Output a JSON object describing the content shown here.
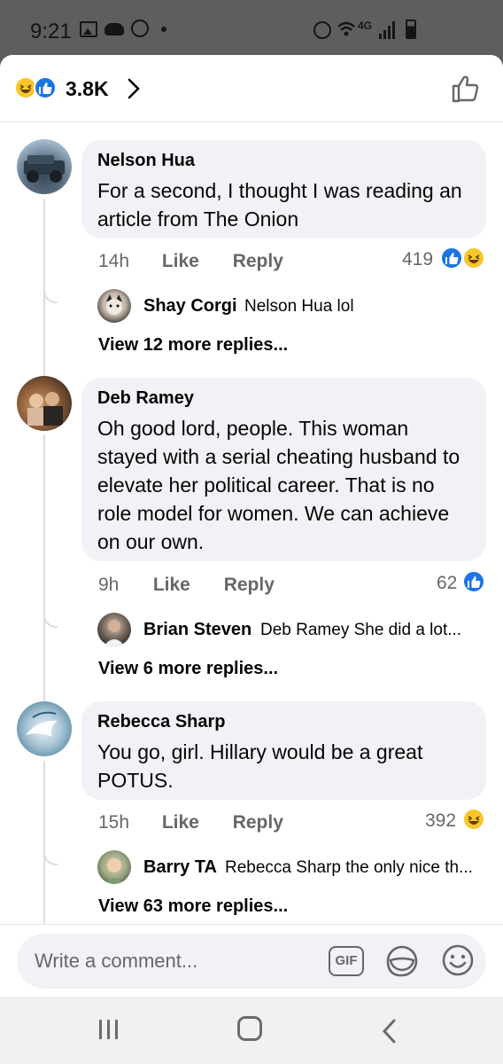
{
  "status_bar": {
    "time": "9:21",
    "network": "4G"
  },
  "header": {
    "reaction_count": "3.8K"
  },
  "comments": [
    {
      "author": "Nelson Hua",
      "text": "For a second, I thought I was reading an article from The Onion",
      "time": "14h",
      "like_label": "Like",
      "reply_label": "Reply",
      "reaction_count": "419",
      "reactions": [
        "like-icon",
        "haha-icon"
      ],
      "reply": {
        "author": "Shay Corgi",
        "text": "Nelson Hua lol"
      },
      "view_more": "View 12 more replies..."
    },
    {
      "author": "Deb Ramey",
      "text": "Oh good lord, people. This woman stayed with a serial cheating husband to elevate her political career. That is no role model for women. We can achieve on our own.",
      "time": "9h",
      "like_label": "Like",
      "reply_label": "Reply",
      "reaction_count": "62",
      "reactions": [
        "like-icon"
      ],
      "reply": {
        "author": "Brian Steven",
        "text": "Deb Ramey She did a lot..."
      },
      "view_more": "View 6 more replies..."
    },
    {
      "author": "Rebecca Sharp",
      "text": "You go, girl.  Hillary would be a great POTUS.",
      "time": "15h",
      "like_label": "Like",
      "reply_label": "Reply",
      "reaction_count": "392",
      "reactions": [
        "haha-icon"
      ],
      "reply": {
        "author": "Barry TA",
        "text": "Rebecca Sharp the only nice th..."
      },
      "view_more": "View 63 more replies..."
    }
  ],
  "composer": {
    "placeholder": "Write a comment...",
    "gif_label": "GIF"
  },
  "colors": {
    "like_blue": "#1b74e4",
    "haha_yellow": "#f7c628",
    "bubble_bg": "#f0f2f5",
    "meta_gray": "#65676b"
  }
}
